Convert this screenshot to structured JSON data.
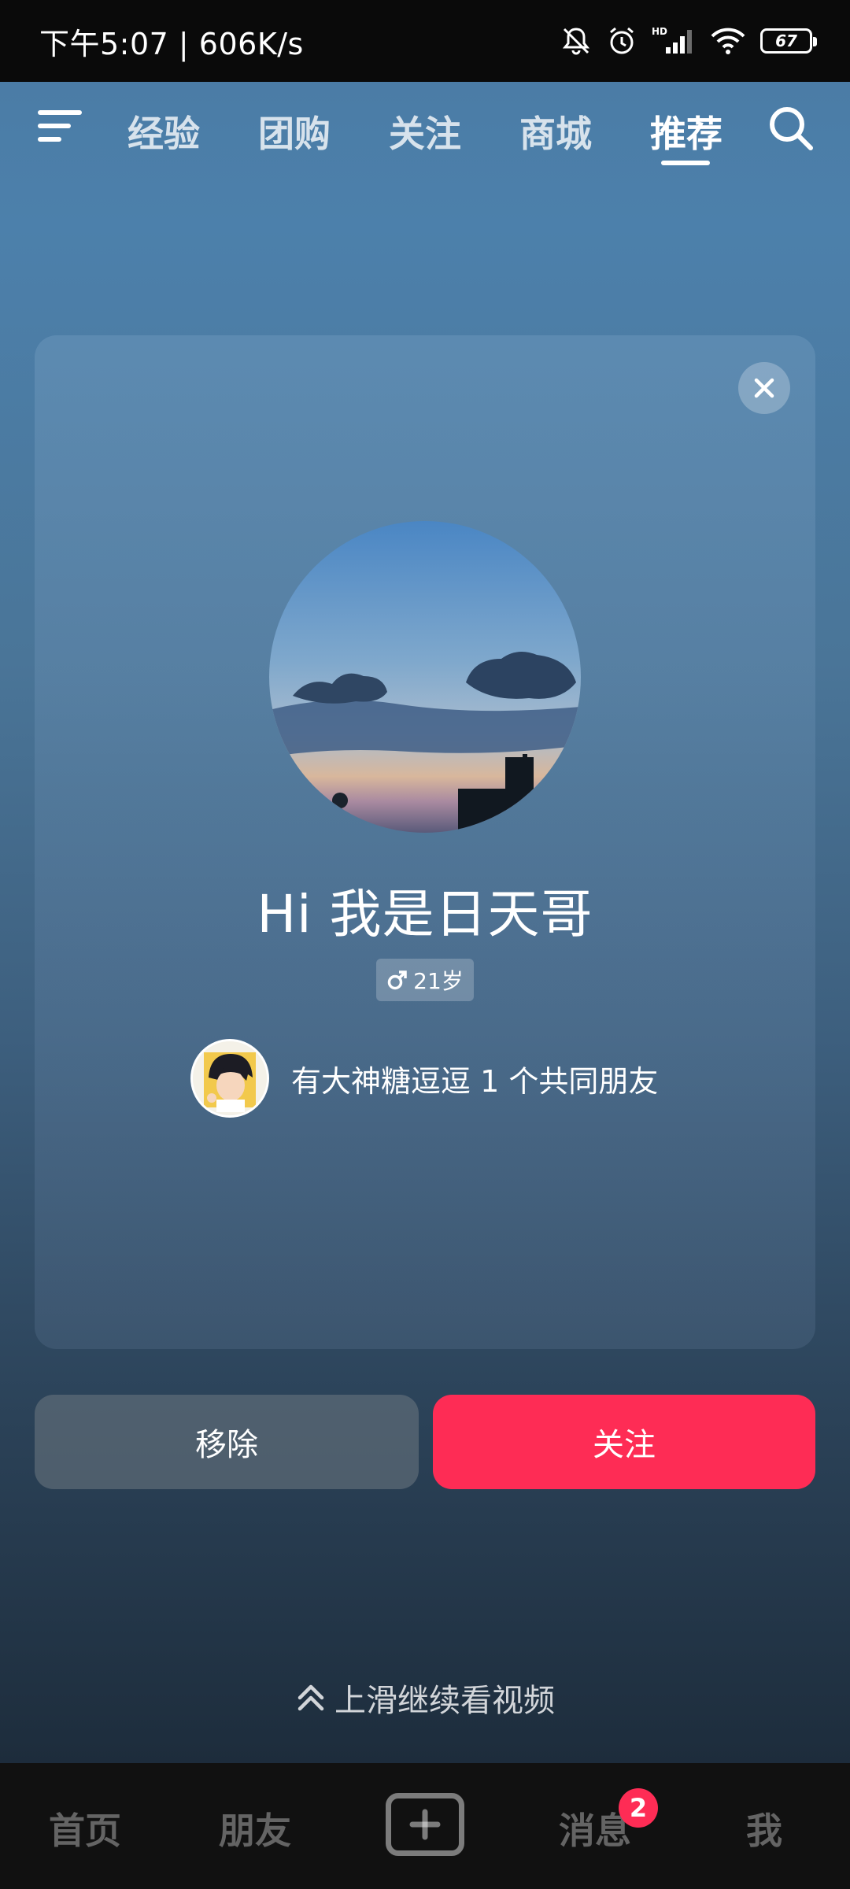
{
  "status_bar": {
    "time_speed": "下午5:07 | 606K/s",
    "battery": "67"
  },
  "top_nav": {
    "tabs": [
      "经验",
      "团购",
      "关注",
      "商城",
      "推荐"
    ],
    "active_tab": "推荐"
  },
  "card": {
    "title": "Hi 我是日天哥",
    "age": "21岁",
    "mutual_friends": "有大神糖逗逗 1 个共同朋友"
  },
  "actions": {
    "remove_label": "移除",
    "follow_label": "关注"
  },
  "swipe_hint": "上滑继续看视频",
  "bottom_nav": {
    "home": "首页",
    "friends": "朋友",
    "messages": "消息",
    "messages_badge": "2",
    "me": "我"
  },
  "colors": {
    "accent": "#fe2c55",
    "status_bar": "#0a0a0a",
    "bottom_bar": "#111111"
  },
  "icons": {
    "menu": "menu-icon",
    "search": "search-icon",
    "close": "close-icon",
    "male": "male-icon",
    "swipe_up": "chevron-up-double-icon",
    "add": "plus-icon"
  }
}
